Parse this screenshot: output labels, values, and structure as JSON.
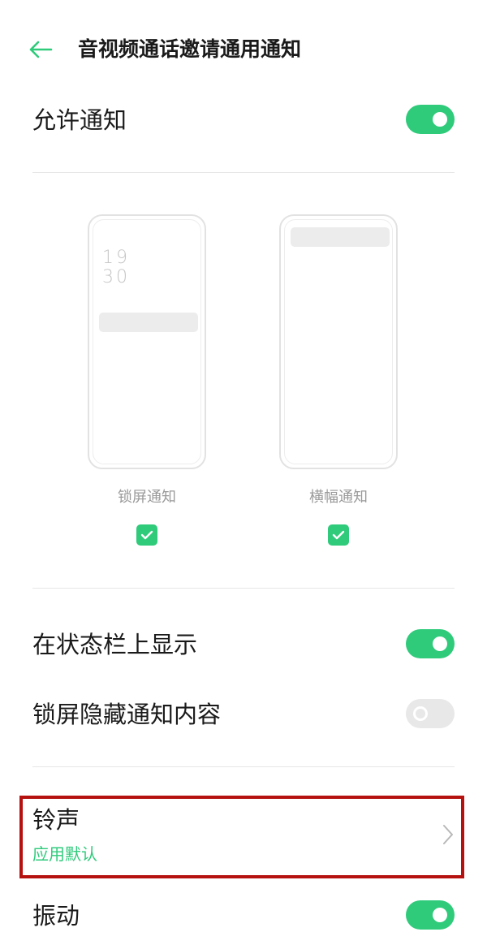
{
  "header": {
    "title": "音视频通话邀请通用通知",
    "back_icon": "arrow-left-icon"
  },
  "allow_notifications": {
    "label": "允许通知",
    "enabled": true
  },
  "previews": {
    "lock_screen": {
      "label": "锁屏通知",
      "clock_hour": "19",
      "clock_minute": "30",
      "checked": true
    },
    "banner": {
      "label": "横幅通知",
      "checked": true
    }
  },
  "settings": {
    "status_bar": {
      "label": "在状态栏上显示",
      "enabled": true
    },
    "hide_lock_content": {
      "label": "锁屏隐藏通知内容",
      "enabled": false
    },
    "ringtone": {
      "label": "铃声",
      "value": "应用默认"
    },
    "vibration": {
      "label": "振动",
      "enabled": true
    }
  },
  "colors": {
    "accent": "#2fcb7b",
    "highlight_border": "#b5110f"
  }
}
